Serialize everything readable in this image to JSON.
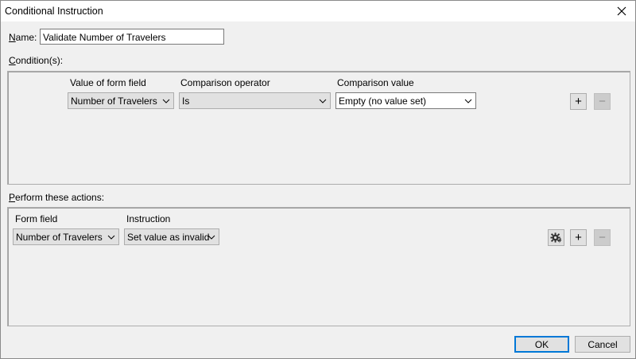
{
  "window": {
    "title": "Conditional Instruction",
    "close_icon": "close-icon"
  },
  "name_field": {
    "label_key": "N",
    "label_rest": "ame:",
    "value": "Validate Number of Travelers"
  },
  "conditions": {
    "section_label_key": "C",
    "section_label_rest": "ondition(s):",
    "headers": {
      "field": "Value of form field",
      "operator": "Comparison operator",
      "value": "Comparison value"
    },
    "row": {
      "field": "Number of Travelers",
      "operator": "Is",
      "value": "Empty (no value set)"
    },
    "add_label": "+",
    "remove_label": "−"
  },
  "actions": {
    "section_label_key": "P",
    "section_label_rest": "erform these actions:",
    "headers": {
      "field": "Form field",
      "instruction": "Instruction"
    },
    "row": {
      "field": "Number of Travelers",
      "instruction": "Set value as invalid"
    },
    "settings_icon": "gear-icon",
    "add_label": "+",
    "remove_label": "−"
  },
  "footer": {
    "ok_label": "OK",
    "cancel_label": "Cancel"
  }
}
